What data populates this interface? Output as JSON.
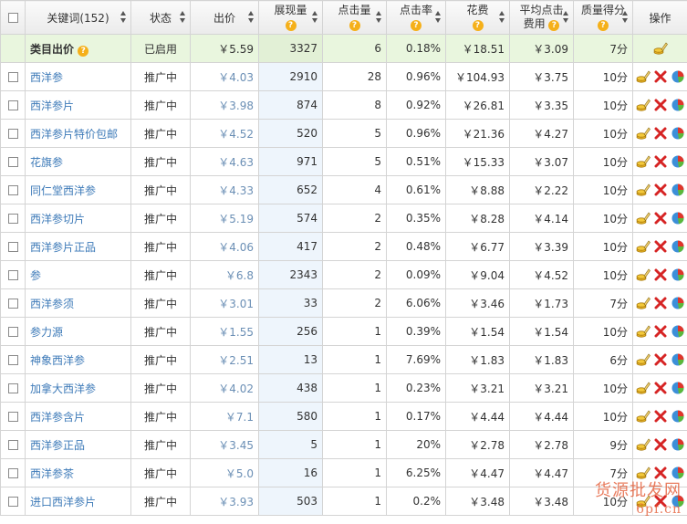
{
  "header": {
    "keyword": "关键词(152)",
    "status": "状态",
    "bid": "出价",
    "impressions": "展现量",
    "clicks": "点击量",
    "ctr": "点击率",
    "cost": "花费",
    "avg_cpc_line1": "平均点击",
    "avg_cpc_line2": "费用",
    "quality": "质量得分",
    "ops": "操作"
  },
  "category_row": {
    "keyword": "类目出价",
    "status": "已启用",
    "bid": "￥5.59",
    "impressions": "3327",
    "clicks": "6",
    "ctr": "0.18%",
    "cost": "￥18.51",
    "avg_cpc": "￥3.09",
    "quality": "7分"
  },
  "rows": [
    {
      "keyword": "西洋参",
      "status": "推广中",
      "bid": "￥4.03",
      "impressions": "2910",
      "clicks": "28",
      "ctr": "0.96%",
      "cost": "￥104.93",
      "avg_cpc": "￥3.75",
      "quality": "10分"
    },
    {
      "keyword": "西洋参片",
      "status": "推广中",
      "bid": "￥3.98",
      "impressions": "874",
      "clicks": "8",
      "ctr": "0.92%",
      "cost": "￥26.81",
      "avg_cpc": "￥3.35",
      "quality": "10分"
    },
    {
      "keyword": "西洋参片特价包邮",
      "status": "推广中",
      "bid": "￥4.52",
      "impressions": "520",
      "clicks": "5",
      "ctr": "0.96%",
      "cost": "￥21.36",
      "avg_cpc": "￥4.27",
      "quality": "10分"
    },
    {
      "keyword": "花旗参",
      "status": "推广中",
      "bid": "￥4.63",
      "impressions": "971",
      "clicks": "5",
      "ctr": "0.51%",
      "cost": "￥15.33",
      "avg_cpc": "￥3.07",
      "quality": "10分"
    },
    {
      "keyword": "同仁堂西洋参",
      "status": "推广中",
      "bid": "￥4.33",
      "impressions": "652",
      "clicks": "4",
      "ctr": "0.61%",
      "cost": "￥8.88",
      "avg_cpc": "￥2.22",
      "quality": "10分"
    },
    {
      "keyword": "西洋参切片",
      "status": "推广中",
      "bid": "￥5.19",
      "impressions": "574",
      "clicks": "2",
      "ctr": "0.35%",
      "cost": "￥8.28",
      "avg_cpc": "￥4.14",
      "quality": "10分"
    },
    {
      "keyword": "西洋参片正品",
      "status": "推广中",
      "bid": "￥4.06",
      "impressions": "417",
      "clicks": "2",
      "ctr": "0.48%",
      "cost": "￥6.77",
      "avg_cpc": "￥3.39",
      "quality": "10分"
    },
    {
      "keyword": "参",
      "status": "推广中",
      "bid": "￥6.8",
      "impressions": "2343",
      "clicks": "2",
      "ctr": "0.09%",
      "cost": "￥9.04",
      "avg_cpc": "￥4.52",
      "quality": "10分"
    },
    {
      "keyword": "西洋参须",
      "status": "推广中",
      "bid": "￥3.01",
      "impressions": "33",
      "clicks": "2",
      "ctr": "6.06%",
      "cost": "￥3.46",
      "avg_cpc": "￥1.73",
      "quality": "7分"
    },
    {
      "keyword": "参力源",
      "status": "推广中",
      "bid": "￥1.55",
      "impressions": "256",
      "clicks": "1",
      "ctr": "0.39%",
      "cost": "￥1.54",
      "avg_cpc": "￥1.54",
      "quality": "10分"
    },
    {
      "keyword": "神象西洋参",
      "status": "推广中",
      "bid": "￥2.51",
      "impressions": "13",
      "clicks": "1",
      "ctr": "7.69%",
      "cost": "￥1.83",
      "avg_cpc": "￥1.83",
      "quality": "6分"
    },
    {
      "keyword": "加拿大西洋参",
      "status": "推广中",
      "bid": "￥4.02",
      "impressions": "438",
      "clicks": "1",
      "ctr": "0.23%",
      "cost": "￥3.21",
      "avg_cpc": "￥3.21",
      "quality": "10分"
    },
    {
      "keyword": "西洋参含片",
      "status": "推广中",
      "bid": "￥7.1",
      "impressions": "580",
      "clicks": "1",
      "ctr": "0.17%",
      "cost": "￥4.44",
      "avg_cpc": "￥4.44",
      "quality": "10分"
    },
    {
      "keyword": "西洋参正品",
      "status": "推广中",
      "bid": "￥3.45",
      "impressions": "5",
      "clicks": "1",
      "ctr": "20%",
      "cost": "￥2.78",
      "avg_cpc": "￥2.78",
      "quality": "9分"
    },
    {
      "keyword": "西洋参茶",
      "status": "推广中",
      "bid": "￥5.0",
      "impressions": "16",
      "clicks": "1",
      "ctr": "6.25%",
      "cost": "￥4.47",
      "avg_cpc": "￥4.47",
      "quality": "7分"
    },
    {
      "keyword": "进口西洋参片",
      "status": "推广中",
      "bid": "￥3.93",
      "impressions": "503",
      "clicks": "1",
      "ctr": "0.2%",
      "cost": "￥3.48",
      "avg_cpc": "￥3.48",
      "quality": "10分"
    }
  ],
  "icons": {
    "edit": "edit-pencil-coins-icon",
    "delete": "delete-x-icon",
    "report": "pie-chart-icon",
    "help": "question-mark-icon"
  },
  "watermark": {
    "line1": "货源批发网",
    "line2": "6pf.cn"
  }
}
